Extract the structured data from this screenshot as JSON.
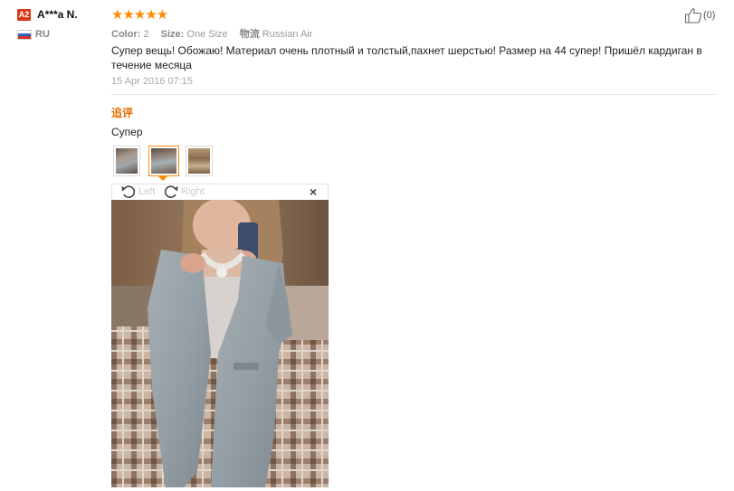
{
  "reviewer": {
    "level": "A2",
    "name": "A***a N.",
    "country": "RU"
  },
  "rating": {
    "stars": 5,
    "max": 5,
    "glyphs": "★★★★★"
  },
  "helpful": {
    "count": "(0)"
  },
  "meta": {
    "color_label": "Color:",
    "color_value": "2",
    "size_label": "Size:",
    "size_value": "One Size",
    "shipping_label": "物流",
    "shipping_value": "Russian Air"
  },
  "review": {
    "text": "Супер вещь! Обожаю! Материал очень плотный и толстый,пахнет шерстью! Размер на 44 супер! Пришёл кардиган в течение месяца",
    "date": "15 Apr 2016 07:15"
  },
  "followup": {
    "label": "追评",
    "text": "Супер"
  },
  "thumbnails": {
    "count": 3,
    "selected_index": 1
  },
  "viewer": {
    "rotate_left_label": "Left",
    "rotate_right_label": "Right",
    "close_glyph": "×"
  },
  "colors": {
    "star": "#ff8a00",
    "badge": "#d9371b",
    "followup": "#e36c00",
    "selected_thumb": "#ff8a00"
  }
}
